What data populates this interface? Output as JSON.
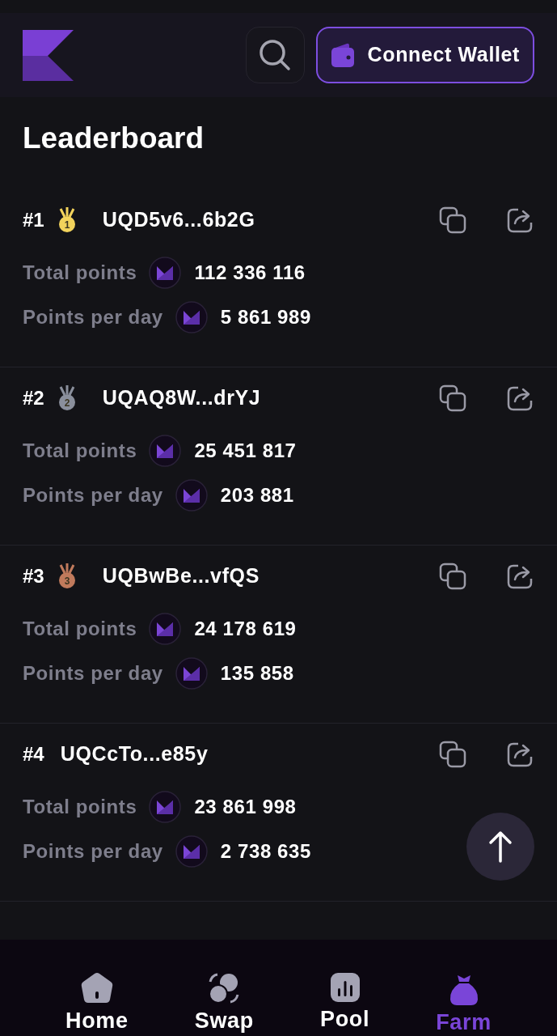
{
  "header": {
    "connect_button": "Connect Wallet"
  },
  "title": "Leaderboard",
  "entries": [
    {
      "rank": "#1",
      "medal": {
        "label": "1",
        "color": "#f2d35c"
      },
      "address": "UQD5v6...6b2G",
      "total_label": "Total points",
      "total": "112 336 116",
      "per_day_label": "Points per day",
      "per_day": "5 861 989"
    },
    {
      "rank": "#2",
      "medal": {
        "label": "2",
        "color": "#8a8f9c"
      },
      "address": "UQAQ8W...drYJ",
      "total_label": "Total points",
      "total": "25 451 817",
      "per_day_label": "Points per day",
      "per_day": "203 881"
    },
    {
      "rank": "#3",
      "medal": {
        "label": "3",
        "color": "#c07a5c"
      },
      "address": "UQBwBe...vfQS",
      "total_label": "Total points",
      "total": "24 178 619",
      "per_day_label": "Points per day",
      "per_day": "135 858"
    },
    {
      "rank": "#4",
      "address": "UQCcTo...e85y",
      "total_label": "Total points",
      "total": "23 861 998",
      "per_day_label": "Points per day",
      "per_day": "2 738 635"
    }
  ],
  "nav": [
    {
      "label": "Home",
      "kind": "home",
      "selected": false
    },
    {
      "label": "Swap",
      "kind": "swap",
      "selected": false
    },
    {
      "label": "Pool",
      "kind": "pool",
      "selected": false
    },
    {
      "label": "Farm",
      "kind": "farm",
      "selected": true
    }
  ]
}
